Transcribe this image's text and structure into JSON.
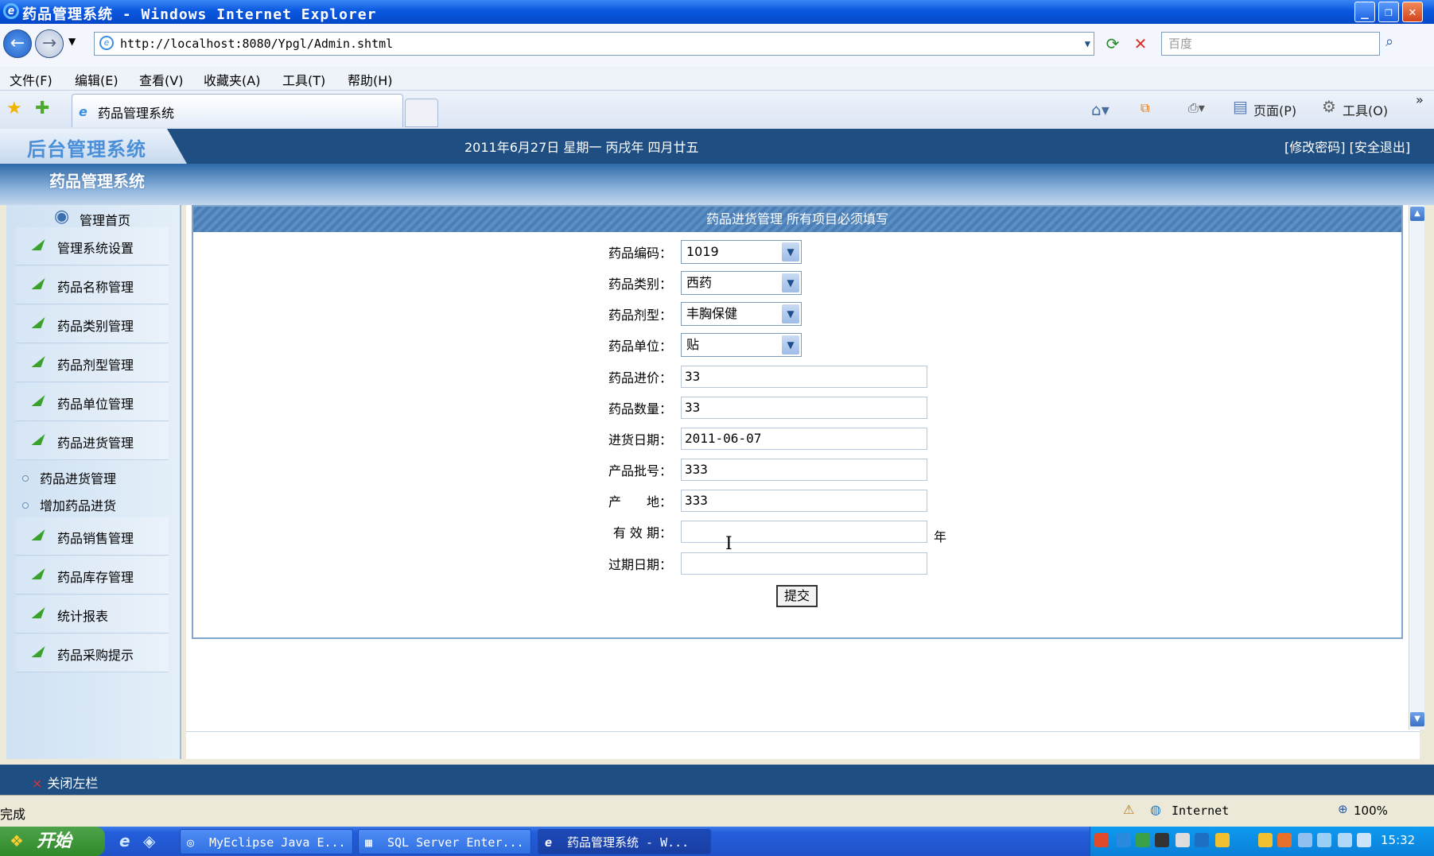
{
  "window": {
    "title": "药品管理系统 - Windows Internet Explorer"
  },
  "browser": {
    "url": "http://localhost:8080/Ypgl/Admin.shtml",
    "search_placeholder": "百度",
    "menu": [
      "文件(F)",
      "编辑(E)",
      "查看(V)",
      "收藏夹(A)",
      "工具(T)",
      "帮助(H)"
    ],
    "tab_title": "药品管理系统",
    "page_cmd": "页面(P)",
    "tools_cmd": "工具(O)"
  },
  "app": {
    "logo_text": "后台管理系统",
    "date_text": "2011年6月27日 星期一 丙戌年 四月廿五",
    "header_links": "[修改密码] [安全退出]",
    "system_title": "药品管理系统",
    "home_label": "管理首页",
    "close_left": "关闭左栏"
  },
  "sidebar": {
    "items": [
      {
        "label": "管理系统设置"
      },
      {
        "label": "药品名称管理"
      },
      {
        "label": "药品类别管理"
      },
      {
        "label": "药品剂型管理"
      },
      {
        "label": "药品单位管理"
      },
      {
        "label": "药品进货管理"
      }
    ],
    "subitems": [
      {
        "label": "药品进货管理"
      },
      {
        "label": "增加药品进货"
      }
    ],
    "items2": [
      {
        "label": "药品销售管理"
      },
      {
        "label": "药品库存管理"
      },
      {
        "label": "统计报表"
      },
      {
        "label": "药品采购提示"
      }
    ]
  },
  "form": {
    "header": "药品进货管理 所有项目必须填写",
    "code": {
      "label": "药品编码：",
      "value": "1019"
    },
    "category": {
      "label": "药品类别：",
      "value": "西药"
    },
    "dosage": {
      "label": "药品剂型：",
      "value": "丰胸保健"
    },
    "unit": {
      "label": "药品单位：",
      "value": "贴"
    },
    "price": {
      "label": "药品进价：",
      "value": "33"
    },
    "quantity": {
      "label": "药品数量：",
      "value": "33"
    },
    "purchase_date": {
      "label": "进货日期：",
      "value": "2011-06-07"
    },
    "batch": {
      "label": "产品批号：",
      "value": "333"
    },
    "origin": {
      "label": "产　　地：",
      "value": "333"
    },
    "validity": {
      "label": "有 效 期：",
      "value": "",
      "suffix": "年"
    },
    "expiry": {
      "label": "过期日期：",
      "value": ""
    },
    "submit": "提交"
  },
  "statusbar": {
    "text": "完成",
    "zone": "Internet",
    "zoom": "100%"
  },
  "taskbar": {
    "start": "开始",
    "tasks": [
      "MyEclipse Java E...",
      "SQL Server Enter...",
      "药品管理系统 - W..."
    ],
    "clock": "15:32"
  }
}
